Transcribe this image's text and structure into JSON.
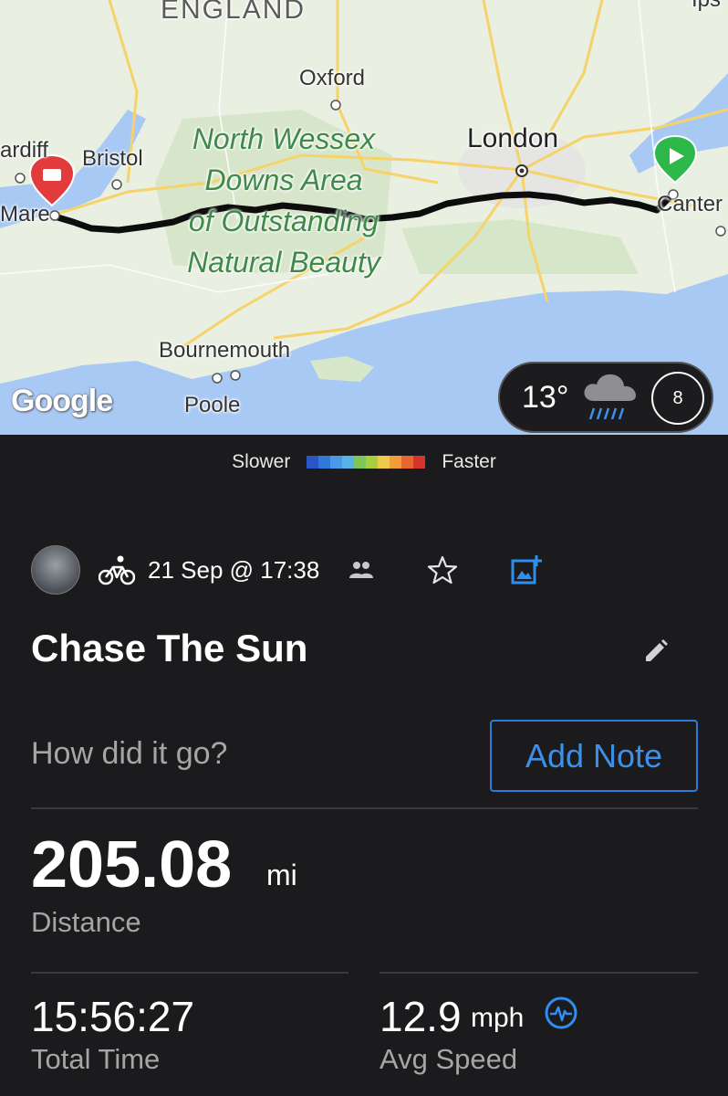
{
  "map": {
    "labels": {
      "country": "ENGLAND",
      "oxford": "Oxford",
      "london": "London",
      "cardiff": "ardiff",
      "bristol": "Bristol",
      "mare": "Mare",
      "canter": "Canter",
      "region_line1": "North Wessex",
      "region_line2": "Downs Area",
      "region_line3": "of Outstanding",
      "region_line4": "Natural Beauty",
      "bournemouth": "Bournemouth",
      "poole": "Poole",
      "ips": "Ips"
    },
    "attribution": "Google",
    "weather": {
      "temperature": "13°",
      "wind_speed": "8",
      "icon": "rain-cloud-icon"
    },
    "start_icon": "green-start-flag-icon",
    "finish_icon": "red-finish-pin-icon"
  },
  "legend": {
    "slower": "Slower",
    "faster": "Faster",
    "colors": [
      "#2a55c4",
      "#2f79d9",
      "#4a98e8",
      "#57b3e6",
      "#7dc55a",
      "#a6cf3b",
      "#f0c84a",
      "#f39c3a",
      "#e8672f",
      "#d6332a"
    ]
  },
  "activity": {
    "type_icon": "bicycle-icon",
    "date": "21 Sep @ 17:38",
    "title": "Chase The Sun",
    "question": "How did it go?",
    "add_note": "Add Note",
    "distance": {
      "value": "205.08",
      "unit": "mi",
      "label": "Distance"
    },
    "total_time": {
      "value": "15:56:27",
      "label": "Total Time"
    },
    "avg_speed": {
      "value": "12.9",
      "unit": "mph",
      "label": "Avg Speed"
    }
  },
  "colors": {
    "accent": "#2b7cd8",
    "background": "#1b1b1d"
  }
}
